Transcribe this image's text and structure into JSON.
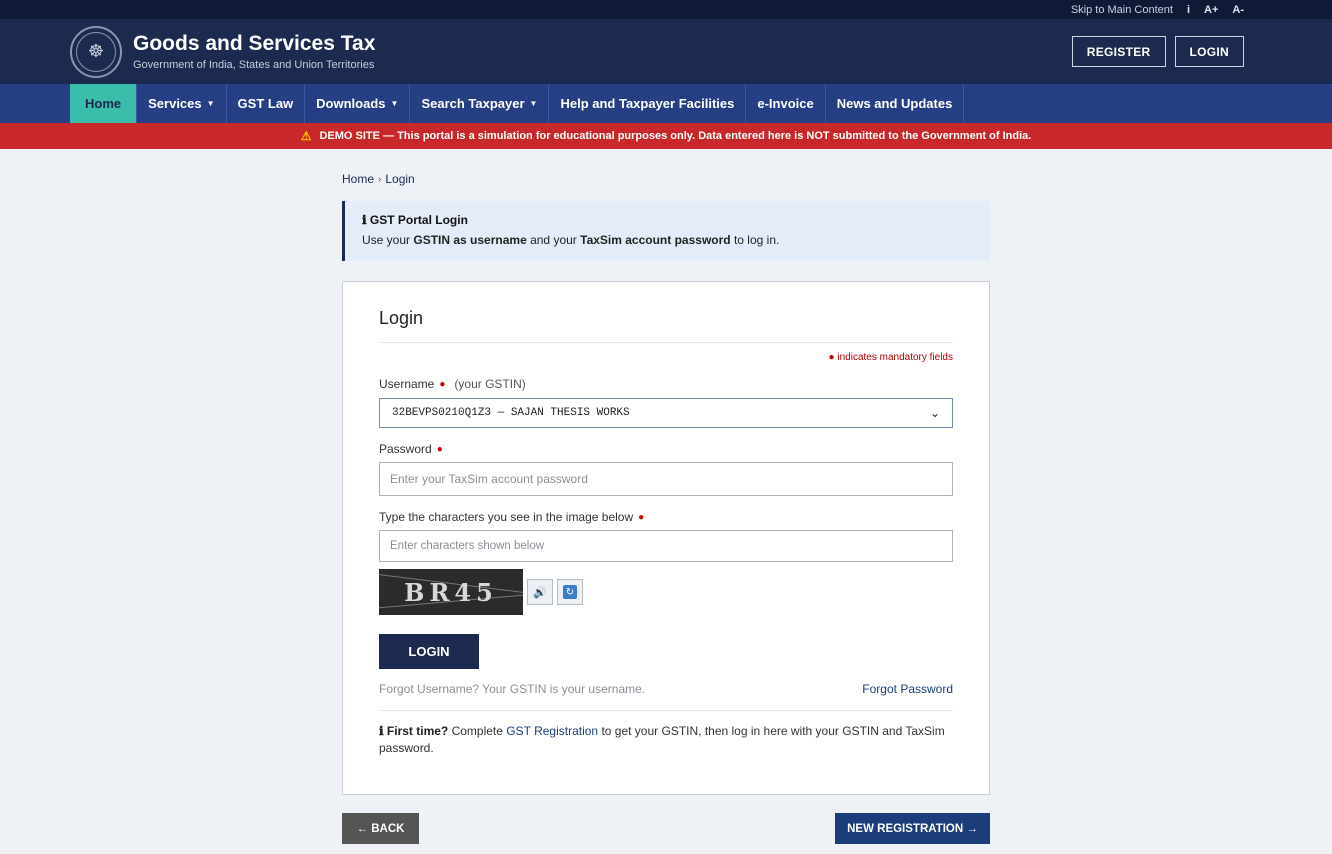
{
  "topbar": {
    "skip": "Skip to Main Content",
    "info": "i",
    "font_increase": "A+",
    "font_decrease": "A-"
  },
  "header": {
    "title": "Goods and Services Tax",
    "subtitle": "Government of India, States and Union Territories",
    "register": "REGISTER",
    "login": "LOGIN"
  },
  "nav": {
    "items": [
      {
        "label": "Home"
      },
      {
        "label": "Services",
        "caret": "▼"
      },
      {
        "label": "GST Law"
      },
      {
        "label": "Downloads",
        "caret": "▼"
      },
      {
        "label": "Search Taxpayer",
        "caret": "▼"
      },
      {
        "label": "Help and Taxpayer Facilities"
      },
      {
        "label": "e-Invoice"
      },
      {
        "label": "News and Updates"
      }
    ]
  },
  "demo_banner": {
    "icon": "⚠",
    "text": "DEMO SITE — This portal is a simulation for educational purposes only. Data entered here is NOT submitted to the Government of India."
  },
  "breadcrumb": {
    "home": "Home",
    "sep": "›",
    "current": "Login"
  },
  "info": {
    "icon": "ℹ",
    "title": "GST Portal Login",
    "text_1": "Use your ",
    "bold_1": "GSTIN as username",
    "text_2": " and your ",
    "bold_2": "TaxSim account password",
    "text_3": " to log in."
  },
  "login_card": {
    "title": "Login",
    "mandatory_note": "indicates mandatory fields",
    "mand_dot": "●",
    "username_label": "Username",
    "username_hint": "(your GSTIN)",
    "username_value": "32BEVPS0210Q1Z3 — SAJAN THESIS WORKS",
    "password_label": "Password",
    "password_placeholder": "Enter your TaxSim account password",
    "captcha_label": "Type the characters you see in the image below",
    "captcha_placeholder": "Enter characters shown below",
    "captcha_text": "BR45",
    "audio_icon": "🔊",
    "refresh_icon": "↻",
    "login_button": "LOGIN",
    "forgot_username": "Forgot Username? Your GSTIN is your username.",
    "forgot_password": "Forgot Password",
    "first_icon": "ℹ",
    "first_time": "First time?",
    "first_text_1": " Complete ",
    "first_link": "GST Registration",
    "first_text_2": " to get your GSTIN, then log in here with your GSTIN and TaxSim password."
  },
  "bottom": {
    "back": "← BACK",
    "new_registration": "NEW REGISTRATION →"
  }
}
